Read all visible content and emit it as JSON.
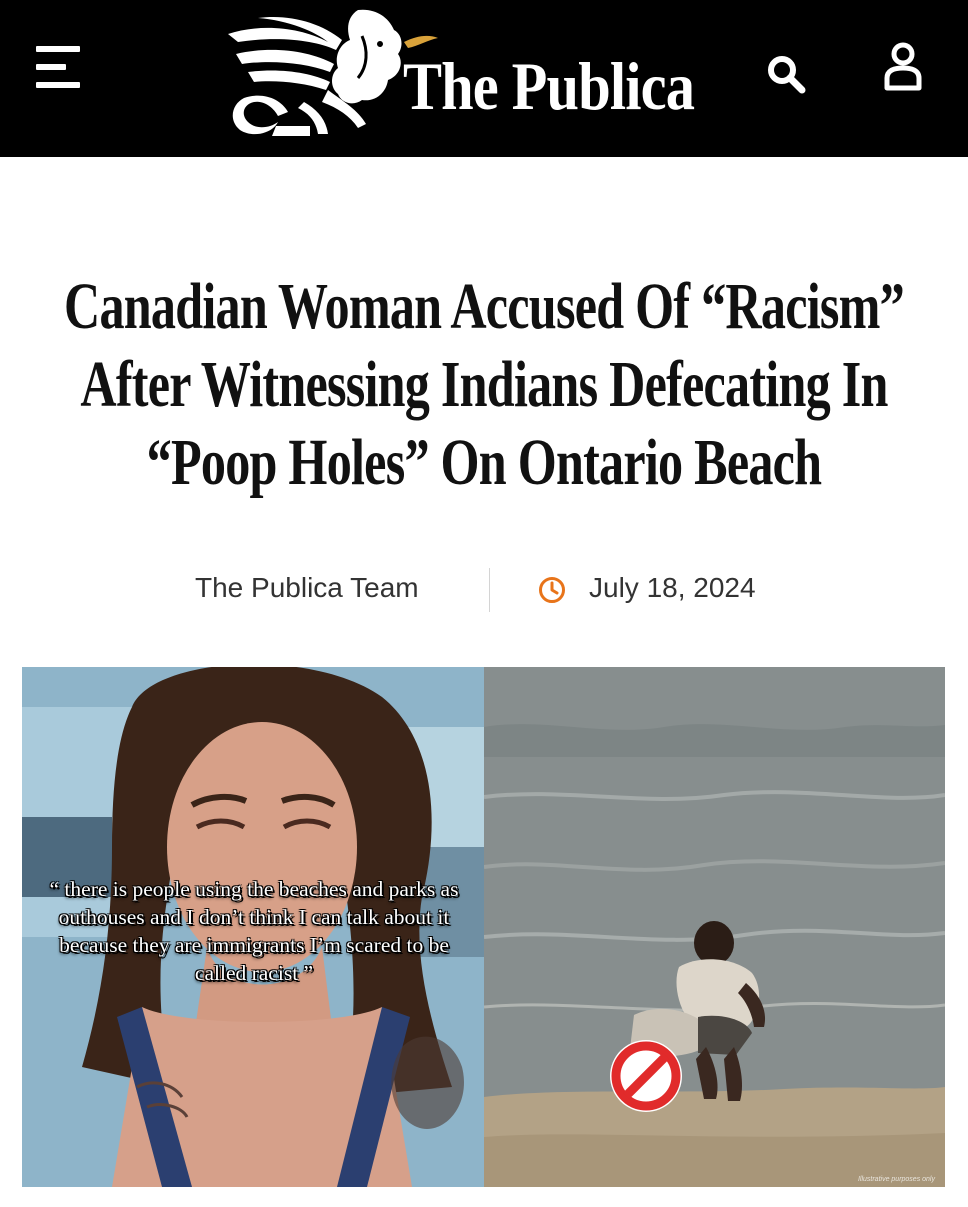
{
  "header": {
    "brand": "The Publica",
    "menu_icon": "hamburger-menu-icon",
    "logo_icon": "griffin-logo-icon",
    "search_icon": "search-icon",
    "account_icon": "user-icon",
    "background": "#000000"
  },
  "article": {
    "headline_lines": [
      "Canadian Woman Accused Of “Racism”",
      "After Witnessing Indians Defecating In",
      "“Poop Holes” On Ontario Beach"
    ],
    "author": "The Publica Team",
    "date": "July 18, 2024",
    "date_icon": "clock-icon",
    "accent_color": "#e8741a"
  },
  "feature_image": {
    "quote": "“ there is people using the beaches and parks as outhouses and I don’t think I can talk about it because they are immigrants I’m scared to be called racist ”",
    "prohibited_icon": "prohibited-icon",
    "credit": "Illustrative purposes only"
  }
}
